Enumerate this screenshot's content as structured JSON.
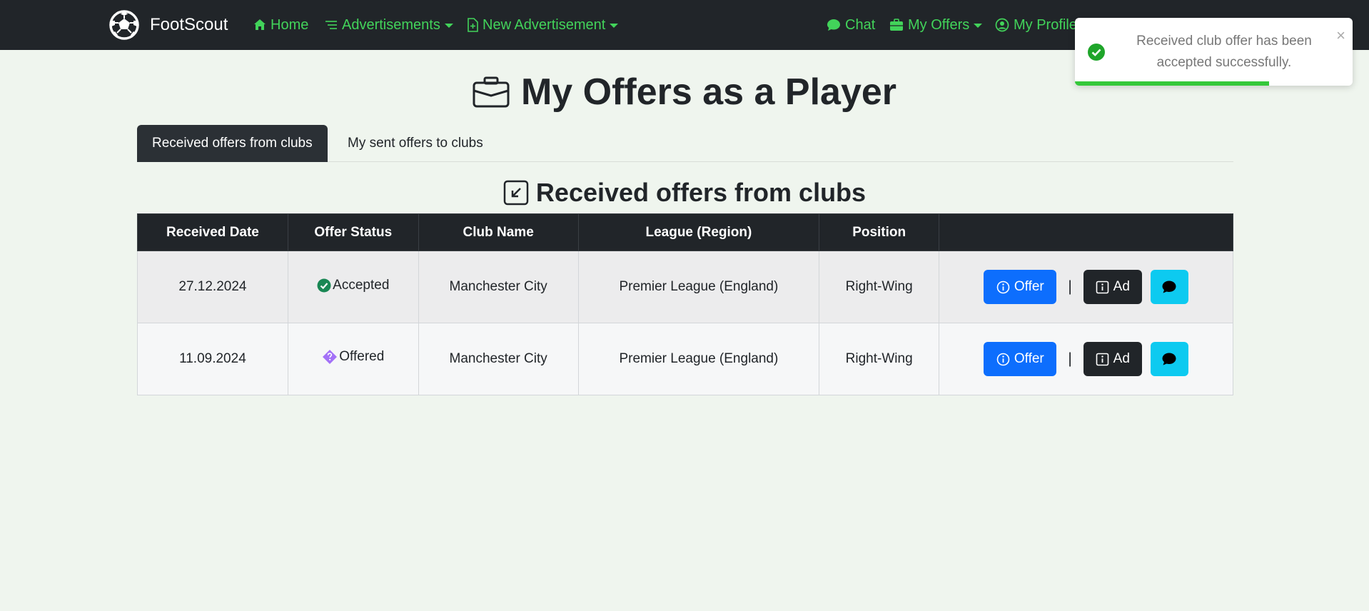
{
  "navbar": {
    "brand": "FootScout",
    "items": [
      {
        "label": "Home"
      },
      {
        "label": "Advertisements"
      },
      {
        "label": "New Advertisement"
      },
      {
        "label": "Chat"
      },
      {
        "label": "My Offers"
      },
      {
        "label": "My Profile"
      }
    ]
  },
  "page": {
    "title": "My Offers as a Player",
    "tabs": [
      {
        "label": "Received offers from clubs"
      },
      {
        "label": "My sent offers to clubs"
      }
    ],
    "section_title": "Received offers from clubs"
  },
  "table": {
    "headers": [
      "Received Date",
      "Offer Status",
      "Club Name",
      "League (Region)",
      "Position",
      ""
    ],
    "rows": [
      {
        "date": "27.12.2024",
        "status": "Accepted",
        "club": "Manchester City",
        "league": "Premier League (England)",
        "position": "Right-Wing"
      },
      {
        "date": "11.09.2024",
        "status": "Offered",
        "club": "Manchester City",
        "league": "Premier League (England)",
        "position": "Right-Wing"
      }
    ],
    "actions": {
      "offer": "Offer",
      "separator": "|",
      "ad": "Ad"
    }
  },
  "toast": {
    "message": "Received club offer has been accepted successfully.",
    "close": "×",
    "progress": 0.7
  },
  "colors": {
    "nav_bg": "#212529",
    "nav_link": "#42d35a",
    "page_bg": "#eff5ee",
    "primary": "#0d6efd",
    "info": "#0dcaf0",
    "success": "#198754",
    "offered": "#a371f7"
  }
}
